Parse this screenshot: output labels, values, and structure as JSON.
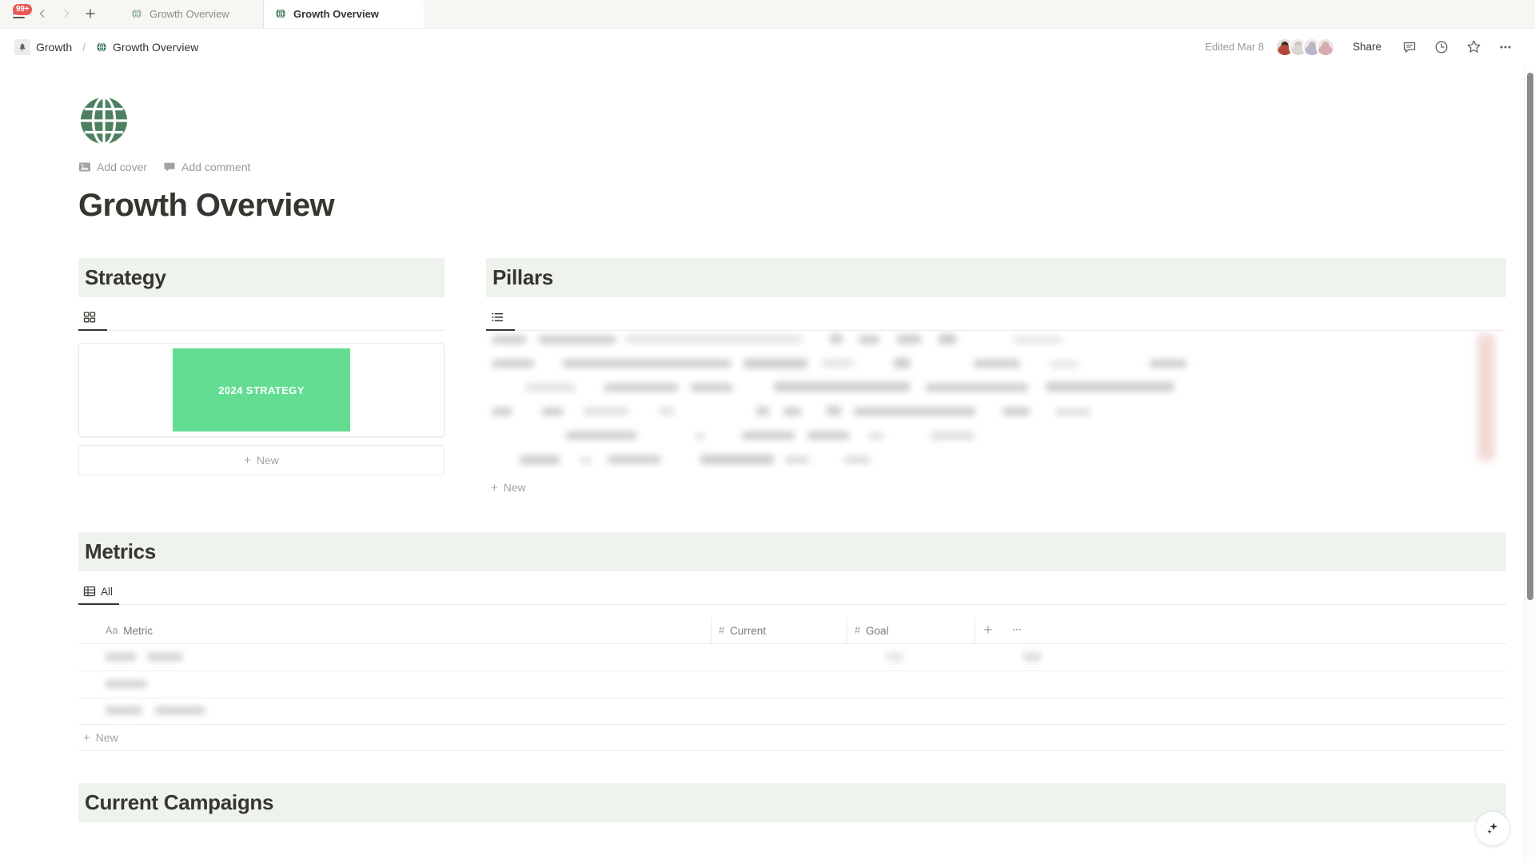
{
  "tabbar": {
    "notification_badge": "99+",
    "menu_icon": "hamburger-icon",
    "back_icon": "chevron-left-icon",
    "forward_icon": "chevron-right-icon",
    "new_tab_icon": "plus-icon",
    "tabs": [
      {
        "label": "Growth Overview",
        "icon": "globe-icon",
        "active": false
      },
      {
        "label": "Growth Overview",
        "icon": "globe-icon",
        "active": true
      }
    ]
  },
  "header": {
    "breadcrumb": [
      {
        "label": "Growth",
        "icon": "pine-tree-icon"
      },
      {
        "label": "Growth Overview",
        "icon": "globe-icon"
      }
    ],
    "separator": "/",
    "edited": "Edited Mar 8",
    "share_label": "Share",
    "icons": {
      "comment": "comment-icon",
      "history": "clock-icon",
      "favorite": "star-icon",
      "more": "more-horizontal-icon"
    },
    "avatars": [
      {
        "name": "collaborator-1",
        "color": "#b04a3a"
      },
      {
        "name": "collaborator-2",
        "color": "#cfc6c2"
      },
      {
        "name": "collaborator-3",
        "color": "#b9b5cb"
      },
      {
        "name": "collaborator-4",
        "color": "#d8aab0"
      }
    ]
  },
  "page": {
    "icon": "globe-emoji",
    "icon_color": "#4c8060",
    "add_cover": "Add cover",
    "add_comment": "Add comment",
    "title": "Growth Overview"
  },
  "strategy": {
    "heading": "Strategy",
    "view_tab": {
      "label": "",
      "icon": "gallery-view-icon"
    },
    "card": {
      "label": "2024 STRATEGY",
      "color": "#62dd92"
    },
    "new_label": "New"
  },
  "pillars": {
    "heading": "Pillars",
    "view_tab": {
      "label": "",
      "icon": "list-view-icon"
    },
    "content_state": "blurred",
    "new_label": "New"
  },
  "metrics": {
    "heading": "Metrics",
    "view_tab": {
      "label": "All",
      "icon": "table-view-icon"
    },
    "columns": [
      {
        "label": "Metric",
        "type_icon": "Aa"
      },
      {
        "label": "Current",
        "type_icon": "#"
      },
      {
        "label": "Goal",
        "type_icon": "#"
      }
    ],
    "add_column_icon": "plus-icon",
    "more_icon": "more-horizontal-icon",
    "rows_state": "blurred",
    "new_label": "New"
  },
  "campaigns": {
    "heading": "Current Campaigns"
  },
  "ai_button": {
    "icon": "sparkle-icon"
  },
  "colors": {
    "section_bg": "#eef3ee",
    "accent_green": "#62dd92",
    "brand_green": "#4c8060",
    "badge_red": "#eb5757"
  }
}
